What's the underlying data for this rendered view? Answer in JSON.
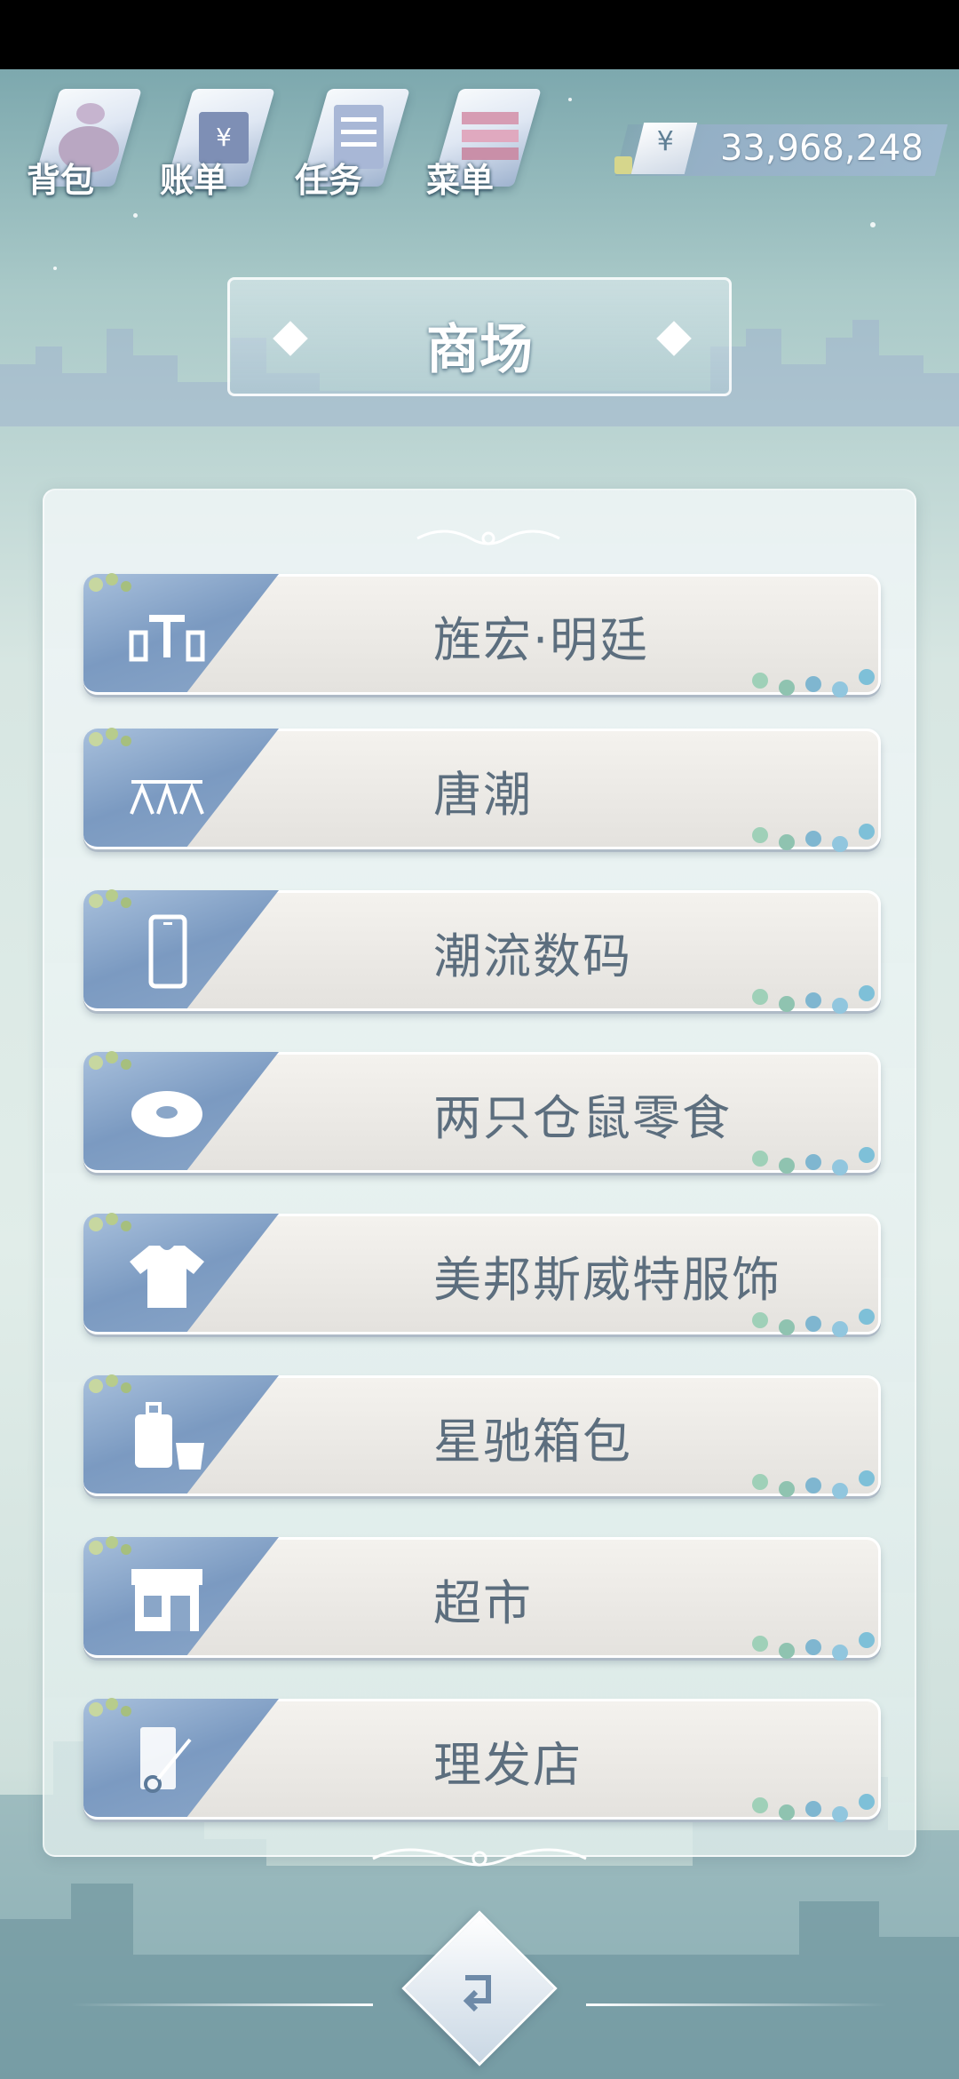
{
  "toolbar": {
    "items": [
      {
        "label": "背包",
        "icon": "backpack-icon"
      },
      {
        "label": "账单",
        "icon": "bill-icon"
      },
      {
        "label": "任务",
        "icon": "task-icon"
      },
      {
        "label": "菜单",
        "icon": "menu-icon"
      }
    ]
  },
  "currency": {
    "symbol": "¥",
    "amount": "33,968,248"
  },
  "page": {
    "title": "商场"
  },
  "shops": [
    {
      "name": "旌宏·明廷",
      "icon": "furniture-icon"
    },
    {
      "name": "唐潮",
      "icon": "clothing-rack-icon"
    },
    {
      "name": "潮流数码",
      "icon": "phone-icon"
    },
    {
      "name": "两只仓鼠零食",
      "icon": "donut-icon"
    },
    {
      "name": "美邦斯威特服饰",
      "icon": "tshirt-icon"
    },
    {
      "name": "星驰箱包",
      "icon": "luggage-icon"
    },
    {
      "name": "超市",
      "icon": "store-icon"
    },
    {
      "name": "理发店",
      "icon": "scissors-comb-icon"
    }
  ],
  "colors": {
    "accent_blue": "#7b9ac1",
    "item_text": "#5c6e7e",
    "panel_bg": "#e6f0ee"
  }
}
